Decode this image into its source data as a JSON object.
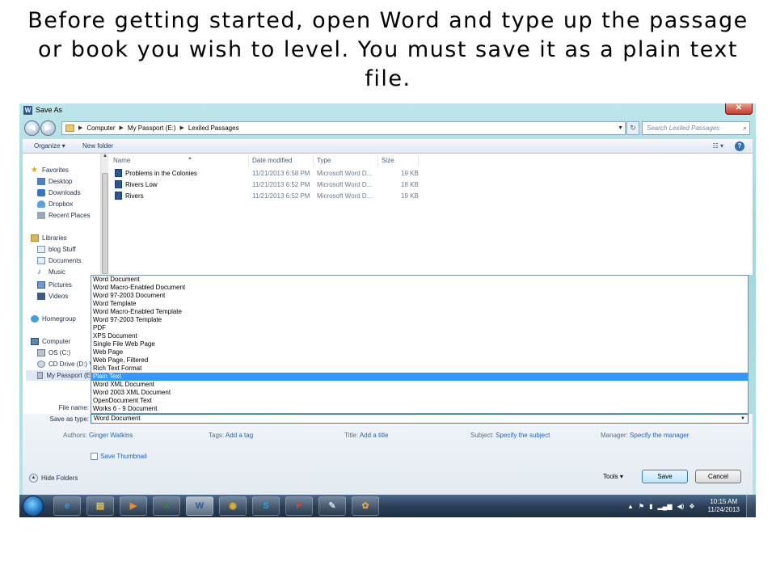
{
  "caption": {
    "line1": "Before getting started, open Word and type up the passage",
    "line2": "or book you wish to level. You must save it as a plain text",
    "line3": "file."
  },
  "window": {
    "title": "Save As",
    "app_icon": "W",
    "close_glyph": "✕"
  },
  "address_bar": {
    "crumbs": [
      "Computer",
      "My Passport (E:)",
      "Lexiled Passages"
    ],
    "search_placeholder": "Search Lexiled Passages"
  },
  "toolbar": {
    "organize_label": "Organize ▾",
    "new_folder_label": "New folder"
  },
  "nav_pane": {
    "favorites": "Favorites",
    "desktop": "Desktop",
    "downloads": "Downloads",
    "dropbox": "Dropbox",
    "recent_places": "Recent Places",
    "libraries": "Libraries",
    "blog_stuff": "blog Stuff",
    "documents": "Documents",
    "music": "Music",
    "pictures": "Pictures",
    "videos": "Videos",
    "homegroup": "Homegroup",
    "computer": "Computer",
    "os": "OS (C:)",
    "cd_drive": "CD Drive (D:) V",
    "my_passport": "My Passport (E"
  },
  "file_list": {
    "columns": [
      "Name",
      "Date modified",
      "Type",
      "Size"
    ],
    "rows": [
      {
        "name": "Problems in the Colonies",
        "date": "11/21/2013 6:58 PM",
        "type": "Microsoft Word D...",
        "size": "19 KB"
      },
      {
        "name": "Rivers Low",
        "date": "11/21/2013 6:52 PM",
        "type": "Microsoft Word D...",
        "size": "18 KB"
      },
      {
        "name": "Rivers",
        "date": "11/21/2013 6:52 PM",
        "type": "Microsoft Word D...",
        "size": "19 KB"
      }
    ]
  },
  "file_types": [
    "Word Document",
    "Word Macro-Enabled Document",
    "Word 97-2003 Document",
    "Word Template",
    "Word Macro-Enabled Template",
    "Word 97-2003 Template",
    "PDF",
    "XPS Document",
    "Single File Web Page",
    "Web Page",
    "Web Page, Filtered",
    "Rich Text Format",
    "Plain Text",
    "Word XML Document",
    "Word 2003 XML Document",
    "OpenDocument Text",
    "Works 6 - 9 Document"
  ],
  "selected_file_type_index": 12,
  "form": {
    "file_name_label": "File name:",
    "save_as_type_label": "Save as type:",
    "save_as_type_value": "Word Document",
    "authors_label": "Authors:",
    "authors_value": "Ginger Watkins",
    "tags_label": "Tags:",
    "tags_value": "Add a tag",
    "title_label": "Title:",
    "title_value": "Add a title",
    "subject_label": "Subject:",
    "subject_value": "Specify the subject",
    "manager_label": "Manager:",
    "manager_value": "Specify the manager",
    "save_thumbnail_label": "Save Thumbnail"
  },
  "buttons": {
    "hide_folders": "Hide Folders",
    "tools": "Tools ▾",
    "save": "Save",
    "cancel": "Cancel"
  },
  "taskbar": {
    "apps": [
      {
        "name": "internet-explorer",
        "glyph": "e",
        "color": "#2f9bde"
      },
      {
        "name": "file-explorer",
        "glyph": "▤",
        "color": "#e8c25a"
      },
      {
        "name": "media-player",
        "glyph": "▶",
        "color": "#f08a1c"
      },
      {
        "name": "excel",
        "glyph": "X",
        "color": "#2d8a3e"
      },
      {
        "name": "word",
        "glyph": "W",
        "color": "#2b5797"
      },
      {
        "name": "chrome",
        "glyph": "◉",
        "color": "#e3b41f"
      },
      {
        "name": "skype",
        "glyph": "S",
        "color": "#1ca7e0"
      },
      {
        "name": "powerpoint",
        "glyph": "P",
        "color": "#d24726"
      },
      {
        "name": "app",
        "glyph": "✎",
        "color": "#c9d6e4"
      },
      {
        "name": "paint",
        "glyph": "✿",
        "color": "#e6a23c"
      }
    ],
    "time": "10:15 AM",
    "date": "11/24/2013"
  }
}
